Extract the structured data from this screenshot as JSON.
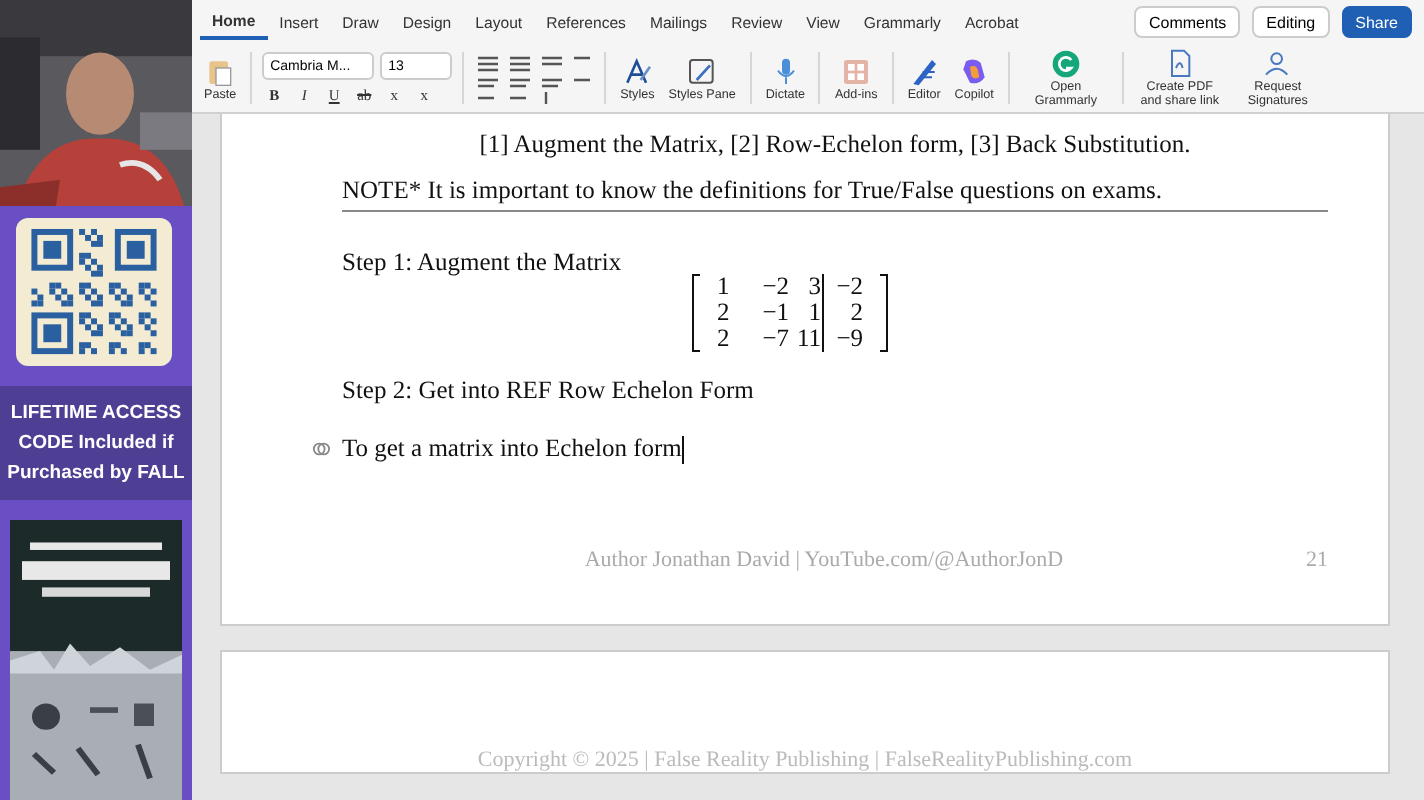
{
  "sidebar": {
    "promo_text": "LIFETIME ACCESS CODE Included if Purchased by FALL"
  },
  "ribbon": {
    "tabs": [
      {
        "label": "Home",
        "selected": true
      },
      {
        "label": "Insert",
        "selected": false
      },
      {
        "label": "Draw",
        "selected": false
      },
      {
        "label": "Design",
        "selected": false
      },
      {
        "label": "Layout",
        "selected": false
      },
      {
        "label": "References",
        "selected": false
      },
      {
        "label": "Mailings",
        "selected": false
      },
      {
        "label": "Review",
        "selected": false
      },
      {
        "label": "View",
        "selected": false
      },
      {
        "label": "Grammarly",
        "selected": false
      },
      {
        "label": "Acrobat",
        "selected": false
      }
    ],
    "actions": [
      {
        "label": "Comments",
        "kind": "comments"
      },
      {
        "label": "Editing",
        "kind": "editing"
      },
      {
        "label": "Share",
        "kind": "share"
      }
    ],
    "paste_label": "Paste",
    "font": "Cambria M...",
    "size": "13",
    "format_buttons": [
      {
        "label": "B",
        "kind": "bold"
      },
      {
        "label": "I",
        "kind": "italic"
      },
      {
        "label": "U",
        "kind": "underline"
      },
      {
        "label": "ab",
        "kind": "strike"
      },
      {
        "label": "x",
        "kind": "sub"
      },
      {
        "label": "x",
        "kind": "sup"
      }
    ],
    "tools": [
      {
        "label": "Styles",
        "kind": "styles"
      },
      {
        "label": "Styles Pane",
        "kind": "pane"
      },
      {
        "label": "Dictate",
        "kind": "mic"
      },
      {
        "label": "Add-ins",
        "kind": "grid"
      },
      {
        "label": "Editor",
        "kind": "pen"
      },
      {
        "label": "Copilot",
        "kind": "copilot"
      },
      {
        "label": "Open Grammarly",
        "kind": "grammarly"
      },
      {
        "label": "Create PDF and share link",
        "kind": "pdf"
      },
      {
        "label": "Request Signatures",
        "kind": "sign"
      }
    ]
  },
  "document": {
    "steps_line": "[1] Augment the Matrix, [2] Row-Echelon form, [3] Back Substitution.",
    "note": "NOTE* It is important to know the definitions for True/False questions on exams.",
    "step1": "Step 1: Augment the Matrix",
    "matrix": [
      [
        "1",
        "−2",
        "3",
        "−2"
      ],
      [
        "2",
        "−1",
        "1",
        "2"
      ],
      [
        "2",
        "−7",
        "11",
        "−9"
      ]
    ],
    "step2": "Step 2: Get into REF Row Echelon Form",
    "body": "To get a matrix into Echelon form",
    "footer": "Author Jonathan David | YouTube.com/@AuthorJonD",
    "page_number": "21",
    "next_page_footer": "Copyright © 2025 | False Reality Publishing | FalseRealityPublishing.com"
  }
}
